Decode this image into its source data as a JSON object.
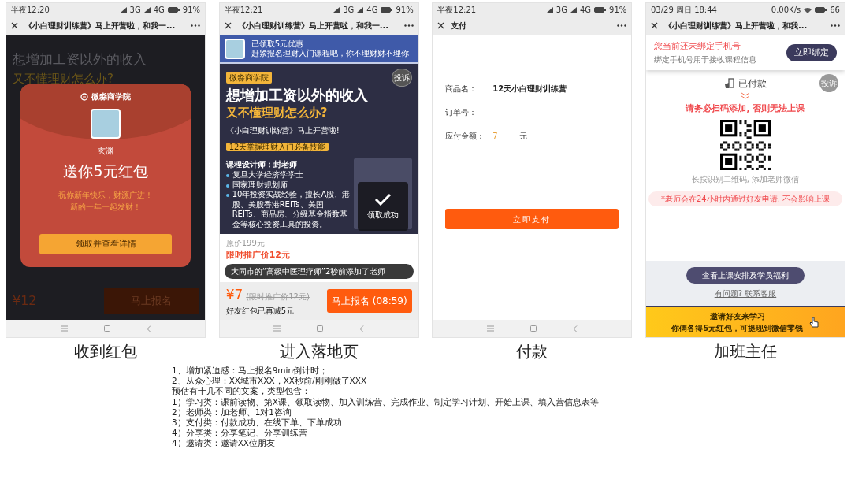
{
  "phones": [
    {
      "kind": "redpacket",
      "caption": "收到红包",
      "status": {
        "time": "半夜12:20",
        "items": [
          {
            "kind": "signal",
            "label": "3G"
          },
          {
            "kind": "signal",
            "label": "4G"
          },
          {
            "kind": "battery",
            "label": "91%"
          }
        ]
      },
      "nav": {
        "title": "《小白理财训练营》马上开营啦，和我一..."
      },
      "system_nav": true,
      "background": {
        "headline": "想增加工资以外的收入",
        "subheadline": "又不懂理财怎么办?",
        "price": "¥12",
        "button": "马上报名"
      },
      "popup": {
        "brand": "微淼商学院",
        "name": "玄渊",
        "title": "送你5元红包",
        "wishes": [
          "祝你新年快乐，财源广进！",
          "新的一年一起发财！"
        ],
        "button": "领取并查看详情"
      }
    },
    {
      "kind": "landing",
      "caption": "进入落地页",
      "status": {
        "time": "半夜12:21",
        "items": [
          {
            "kind": "signal",
            "label": "3G"
          },
          {
            "kind": "signal",
            "label": "4G"
          },
          {
            "kind": "battery",
            "label": "91%"
          }
        ]
      },
      "nav": {
        "title": "《小白理财训练营》马上开营啦，和我一..."
      },
      "system_nav": true,
      "banner": {
        "title": "已领取5元优惠",
        "subtitle": "赶紧报名理财入门课程吧，你不理财财不理你"
      },
      "poster": {
        "tag": "微淼商学院",
        "complaint": "投诉",
        "headline": "想增加工资以外的收入",
        "subheadline": "又不懂理财怎么办?",
        "intro": "《小白理财训练营》马上开营啦!",
        "highlight": "12天掌握理财入门必备技能",
        "designer": "课程设计师：封老师",
        "bullets": [
          "复旦大学经济学学士",
          "国家理财规划师",
          "10年投资实战经验，擅长A股、港股、美股香港REITs、美国REITs、商品房、分级基金指数基金等核心投资工具的投资。"
        ]
      },
      "toast": "领取成功",
      "prices": [
        {
          "kind": "plain",
          "text": "原价199元"
        },
        {
          "kind": "promo",
          "text": "限时推广价12元"
        }
      ],
      "notification": "大同市的“高级中医理疗师”2秒前添加了老师",
      "footer": {
        "price": "¥7",
        "old_price": "(限时推广价12元)",
        "note": "好友红包已再减5元",
        "button": "马上报名 (08:59)"
      }
    },
    {
      "kind": "payment",
      "caption": "付款",
      "status": {
        "time": "半夜12:21",
        "items": [
          {
            "kind": "signal",
            "label": "3G"
          },
          {
            "kind": "signal",
            "label": "4G"
          },
          {
            "kind": "battery",
            "label": "91%"
          }
        ]
      },
      "nav": {
        "title": "支付"
      },
      "system_nav": true,
      "fields": [
        {
          "kind": "text",
          "label": "商品名：",
          "value": "12天小白理财训练营"
        },
        {
          "kind": "text",
          "label": "订单号："
        },
        {
          "kind": "amount",
          "label": "应付金额：",
          "value": "7",
          "unit": "元"
        }
      ],
      "button": "立即支付"
    },
    {
      "kind": "class",
      "caption": "加班主任",
      "status": {
        "time": "03/29 周日 18:44",
        "items": [
          {
            "kind": "text",
            "label": "0.00K/s"
          },
          {
            "kind": "wifi"
          },
          {
            "kind": "battery",
            "label": "66"
          }
        ]
      },
      "nav": {
        "title": "《小白理财训练营》马上开营啦，和我..."
      },
      "system_nav": false,
      "bind": {
        "title": "您当前还未绑定手机号",
        "subtitle": "绑定手机号用于接收课程信息",
        "button": "立即绑定"
      },
      "paid": "已付款",
      "complaint": "投诉",
      "warning": "请务必扫码添加, 否则无法上课",
      "qr_hint": "长按识别二维码, 添加老师微信",
      "notice": "*老师会在24小时内通过好友申请, 不会影响上课",
      "schedule_button": "查看上课安排及学员福利",
      "help_link": "有问题? 联系客服",
      "invite": [
        "邀请好友来学习",
        "你俩各得5元红包，可提现到微信零钱"
      ]
    }
  ],
  "notes": [
    "1、增加紧迫感：马上报名9min倒计时；",
    "2、从众心理：XX城市XXX，XX秒前/刚刚做了XXX",
    "预估有十几不同的文案，类型包含：",
    "1）学习类：课前读物、第X课、领取读物、加入训练营、完成作业、制定学习计划、开始上课、填入营信息表等",
    "2）老师类：加老师、1对1咨询",
    "3）支付类：付款成功、在线下单、下单成功",
    "4）分享类：分享笔记、分享训练营",
    "4）邀请类：邀请XX位朋友"
  ]
}
